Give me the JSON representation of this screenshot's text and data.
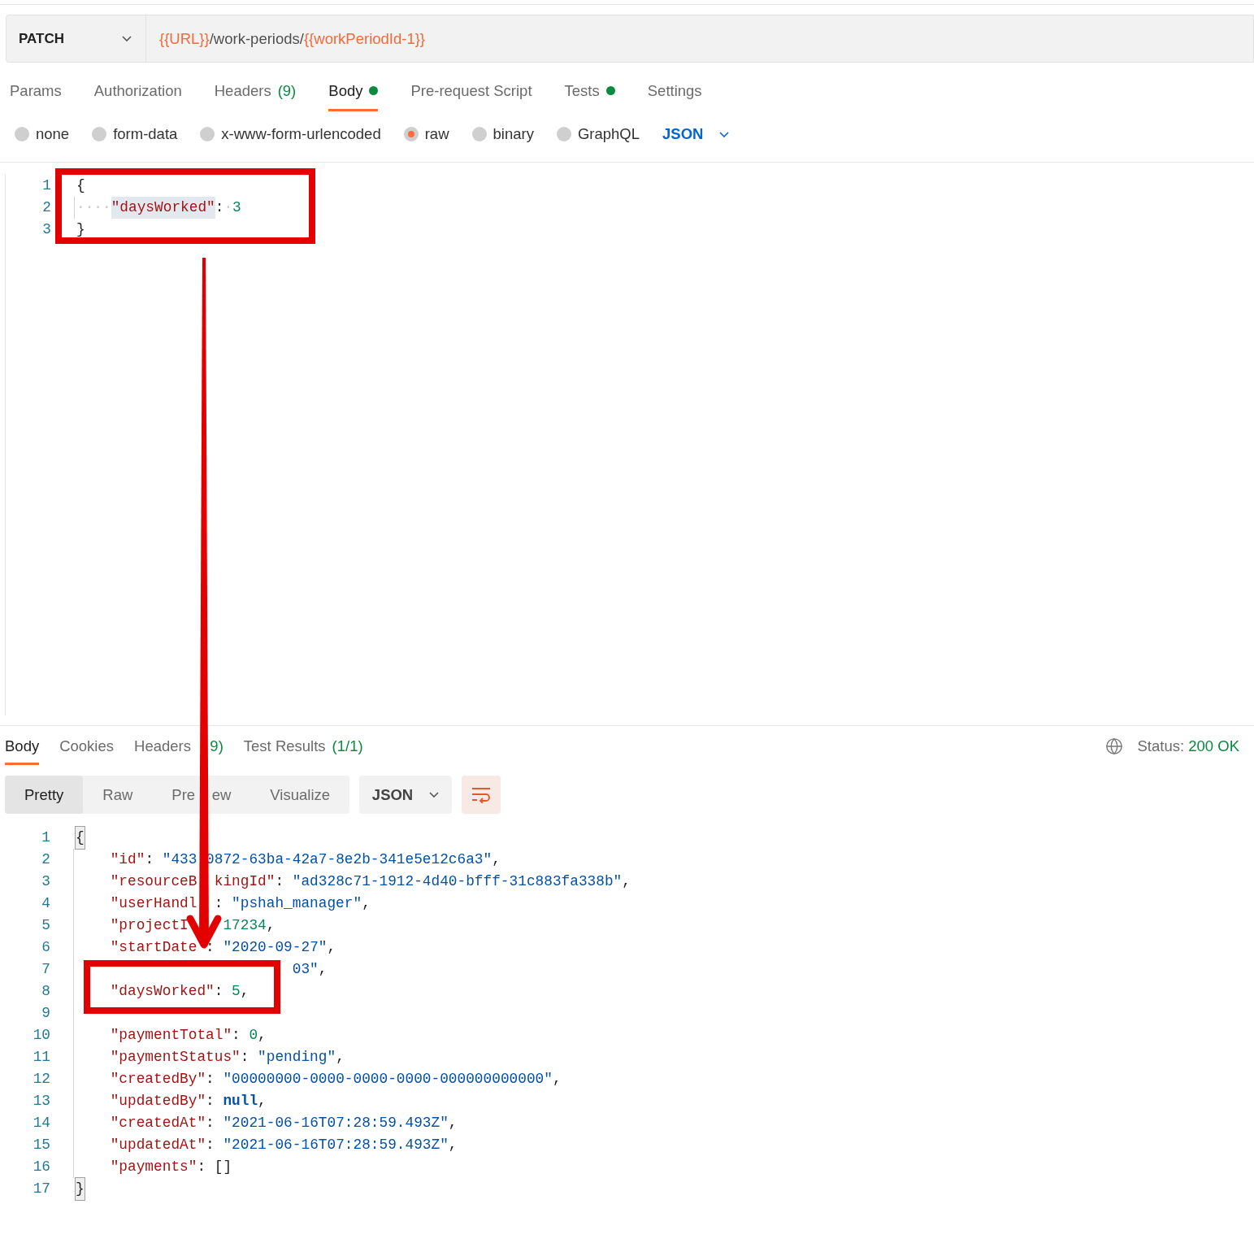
{
  "request": {
    "method": "PATCH",
    "url": [
      {
        "kind": "variable",
        "text": "{{URL}}"
      },
      {
        "kind": "literal",
        "text": "/work-periods/"
      },
      {
        "kind": "variable",
        "text": "{{workPeriodId-1}}"
      }
    ]
  },
  "request_tabs": [
    {
      "label": "Params",
      "selected": false
    },
    {
      "label": "Authorization",
      "selected": false
    },
    {
      "label": "Headers",
      "count": "(9)",
      "selected": false
    },
    {
      "label": "Body",
      "dot": true,
      "selected": true
    },
    {
      "label": "Pre-request Script",
      "selected": false
    },
    {
      "label": "Tests",
      "dot": true,
      "selected": false
    },
    {
      "label": "Settings",
      "selected": false
    }
  ],
  "body_types": [
    {
      "label": "none",
      "selected": false
    },
    {
      "label": "form-data",
      "selected": false
    },
    {
      "label": "x-www-form-urlencoded",
      "selected": false
    },
    {
      "label": "raw",
      "selected": true
    },
    {
      "label": "binary",
      "selected": false
    },
    {
      "label": "GraphQL",
      "selected": false
    }
  ],
  "body_format": "JSON",
  "editor_lines": [
    {
      "number": "1",
      "tokens": [
        {
          "kind": "punct",
          "text": "{"
        }
      ]
    },
    {
      "number": "2",
      "tokens": [
        {
          "kind": "whitespace",
          "text": "····"
        },
        {
          "kind": "key",
          "text": "\"daysWorked\"",
          "highlighted": true
        },
        {
          "kind": "punct",
          "text": ":"
        },
        {
          "kind": "whitespace",
          "text": "·"
        },
        {
          "kind": "number",
          "text": "3"
        }
      ]
    },
    {
      "number": "3",
      "tokens": [
        {
          "kind": "punct",
          "text": "}"
        }
      ]
    }
  ],
  "response_tabs": [
    {
      "label": "Body",
      "selected": true
    },
    {
      "label": "Cookies",
      "selected": false
    },
    {
      "label": "Headers",
      "count": "   9)",
      "selected": false
    },
    {
      "label": "Test Results",
      "count": "(1/1)",
      "selected": false
    }
  ],
  "status": {
    "label": "Status:",
    "value": "200 OK"
  },
  "view_modes": [
    {
      "label": "Pretty",
      "selected": true
    },
    {
      "label": "Raw",
      "selected": false
    },
    {
      "label": "Pre    ew",
      "selected": false
    },
    {
      "label": "Visualize",
      "selected": false
    }
  ],
  "response_format": "JSON",
  "wrap_lines": true,
  "response_lines": [
    {
      "number": "1",
      "tokens": [
        {
          "kind": "brace-match",
          "text": "{"
        }
      ],
      "children": [
        {
          "number": "2",
          "tokens": [
            {
              "kind": "key",
              "text": "\"id\""
            },
            {
              "kind": "punct",
              "text": ": "
            },
            {
              "kind": "string",
              "text": "\"433 0872-63ba-42a7-8e2b-341e5e12c6a3\""
            },
            {
              "kind": "punct",
              "text": ","
            }
          ]
        },
        {
          "number": "3",
          "tokens": [
            {
              "kind": "key",
              "text": "\"resourceB  kingId\""
            },
            {
              "kind": "punct",
              "text": ": "
            },
            {
              "kind": "string",
              "text": "\"ad328c71-1912-4d40-bfff-31c883fa338b\""
            },
            {
              "kind": "punct",
              "text": ","
            }
          ]
        },
        {
          "number": "4",
          "tokens": [
            {
              "kind": "key",
              "text": "\"userHandl  "
            },
            {
              "kind": "punct",
              "text": ": "
            },
            {
              "kind": "string",
              "text": "\"pshah_manager\""
            },
            {
              "kind": "punct",
              "text": ","
            }
          ]
        },
        {
          "number": "5",
          "tokens": [
            {
              "kind": "key",
              "text": "\"projectI    "
            },
            {
              "kind": "number",
              "text": "17234"
            },
            {
              "kind": "punct",
              "text": ","
            }
          ]
        },
        {
          "number": "6",
          "tokens": [
            {
              "kind": "key",
              "text": "\"startDate "
            },
            {
              "kind": "punct",
              "text": ": "
            },
            {
              "kind": "string",
              "text": "\"2020-09-27\""
            },
            {
              "kind": "punct",
              "text": ","
            }
          ]
        },
        {
          "number": "7",
          "tokens": [
            {
              "kind": "string",
              "text": "                     03\""
            },
            {
              "kind": "punct",
              "text": ","
            }
          ]
        },
        {
          "number": "8",
          "tokens": [
            {
              "kind": "key",
              "text": "\"daysWorked\""
            },
            {
              "kind": "punct",
              "text": ": "
            },
            {
              "kind": "number",
              "text": "5"
            },
            {
              "kind": "punct",
              "text": ","
            }
          ]
        },
        {
          "number": "9"
        },
        {
          "number": "10",
          "tokens": [
            {
              "kind": "key",
              "text": "\"paymentTotal\""
            },
            {
              "kind": "punct",
              "text": ": "
            },
            {
              "kind": "number",
              "text": "0"
            },
            {
              "kind": "punct",
              "text": ","
            }
          ]
        },
        {
          "number": "11",
          "tokens": [
            {
              "kind": "key",
              "text": "\"paymentStatus\""
            },
            {
              "kind": "punct",
              "text": ": "
            },
            {
              "kind": "string",
              "text": "\"pending\""
            },
            {
              "kind": "punct",
              "text": ","
            }
          ]
        },
        {
          "number": "12",
          "tokens": [
            {
              "kind": "key",
              "text": "\"createdBy\""
            },
            {
              "kind": "punct",
              "text": ": "
            },
            {
              "kind": "string",
              "text": "\"00000000-0000-0000-0000-000000000000\""
            },
            {
              "kind": "punct",
              "text": ","
            }
          ]
        },
        {
          "number": "13",
          "tokens": [
            {
              "kind": "key",
              "text": "\"updatedBy\""
            },
            {
              "kind": "punct",
              "text": ": "
            },
            {
              "kind": "keyword",
              "text": "null"
            },
            {
              "kind": "punct",
              "text": ","
            }
          ]
        },
        {
          "number": "14",
          "tokens": [
            {
              "kind": "key",
              "text": "\"createdAt\""
            },
            {
              "kind": "punct",
              "text": ": "
            },
            {
              "kind": "string",
              "text": "\"2021-06-16T07:28:59.493Z\""
            },
            {
              "kind": "punct",
              "text": ","
            }
          ]
        },
        {
          "number": "15",
          "tokens": [
            {
              "kind": "key",
              "text": "\"updatedAt\""
            },
            {
              "kind": "punct",
              "text": ": "
            },
            {
              "kind": "string",
              "text": "\"2021-06-16T07:28:59.493Z\""
            },
            {
              "kind": "punct",
              "text": ","
            }
          ]
        },
        {
          "number": "16",
          "tokens": [
            {
              "kind": "key",
              "text": "\"payments\""
            },
            {
              "kind": "punct",
              "text": ": "
            },
            {
              "kind": "punct",
              "text": "[]"
            }
          ]
        }
      ]
    },
    {
      "number": "17",
      "tokens": [
        {
          "kind": "brace-match",
          "text": "}"
        }
      ]
    }
  ]
}
